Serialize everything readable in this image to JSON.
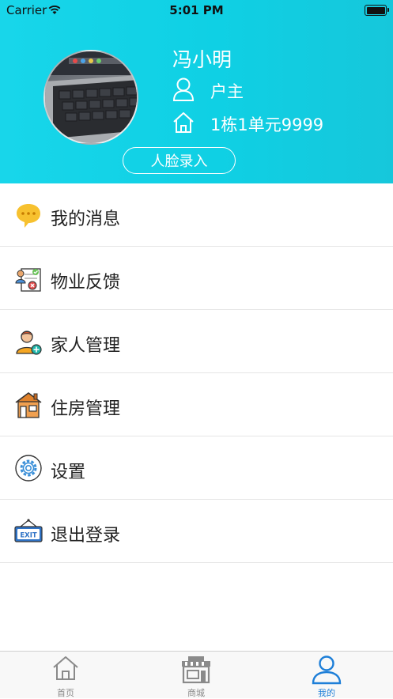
{
  "status_bar": {
    "carrier": "Carrier",
    "time": "5:01 PM"
  },
  "profile": {
    "name": "冯小明",
    "role": "户主",
    "address": "1栋1单元9999",
    "face_button": "人脸录入"
  },
  "menu": {
    "items": [
      {
        "label": "我的消息",
        "icon": "message-bubble-icon"
      },
      {
        "label": "物业反馈",
        "icon": "feedback-icon"
      },
      {
        "label": "家人管理",
        "icon": "family-user-icon"
      },
      {
        "label": "住房管理",
        "icon": "house-management-icon"
      },
      {
        "label": "设置",
        "icon": "gear-icon"
      },
      {
        "label": "退出登录",
        "icon": "exit-sign-icon"
      }
    ]
  },
  "tabbar": {
    "tabs": [
      {
        "label": "首页",
        "icon": "home-icon"
      },
      {
        "label": "商城",
        "icon": "shop-icon"
      },
      {
        "label": "我的",
        "icon": "user-icon",
        "active": true
      }
    ]
  },
  "colors": {
    "header": "#12d3e7",
    "accent": "#1e7fd8"
  }
}
